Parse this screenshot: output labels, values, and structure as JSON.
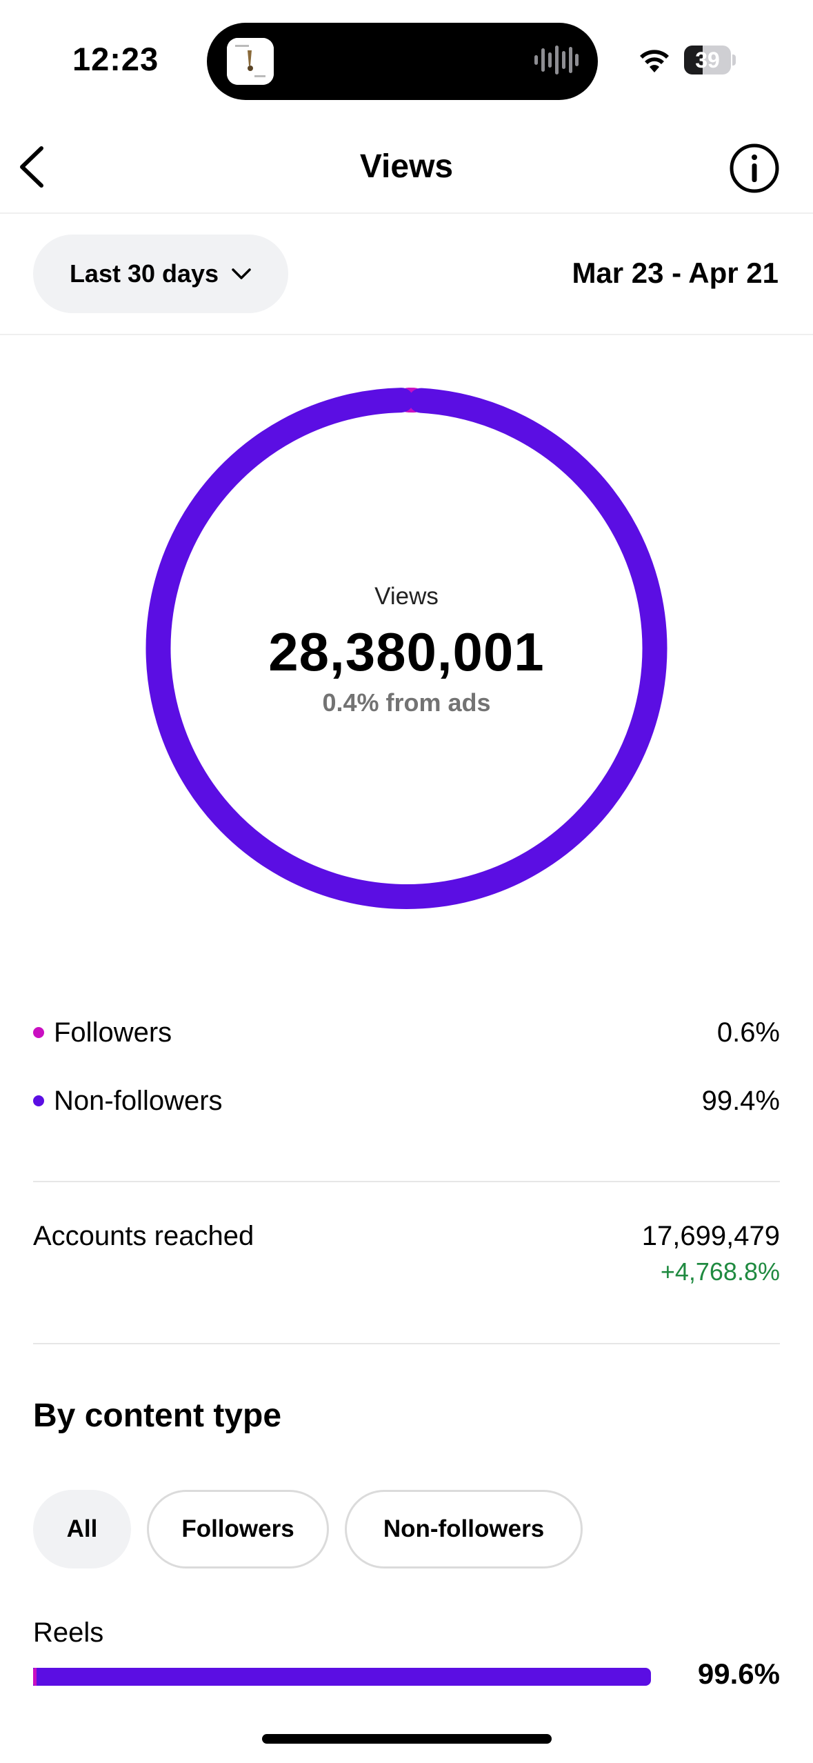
{
  "status_bar": {
    "time": "12:23",
    "battery": "39",
    "battery_level": 0.39,
    "icons": [
      "wifi-icon",
      "battery-icon",
      "waveform-icon"
    ]
  },
  "nav": {
    "title": "Views",
    "back_icon": "chevron-left-icon",
    "info_icon": "info-icon"
  },
  "filter": {
    "range_label": "Last 30 days",
    "dropdown_icon": "chevron-down-icon",
    "date_range": "Mar 23 - Apr 21"
  },
  "summary": {
    "label": "Views",
    "value": "28,380,001",
    "subtext": "0.4% from ads"
  },
  "chart_data": {
    "type": "pie",
    "categories": [
      "Followers",
      "Non-followers"
    ],
    "values": [
      0.6,
      99.4
    ],
    "colors": [
      "#c90fc1",
      "#5b0ee3"
    ]
  },
  "legend": [
    {
      "label": "Followers",
      "value": "0.6%",
      "color": "#c90fc1"
    },
    {
      "label": "Non-followers",
      "value": "99.4%",
      "color": "#5b0ee3"
    }
  ],
  "accounts_reached": {
    "label": "Accounts reached",
    "value": "17,699,479",
    "change": "+4,768.8%",
    "change_color": "#1f8a40"
  },
  "content_type": {
    "title": "By content type",
    "chips": [
      "All",
      "Followers",
      "Non-followers"
    ],
    "selected": "All",
    "rows": [
      {
        "label": "Reels",
        "value": "99.6%",
        "fill": 0.996,
        "color": "#5b0ee3",
        "cap_color": "#c90fc1"
      }
    ]
  }
}
